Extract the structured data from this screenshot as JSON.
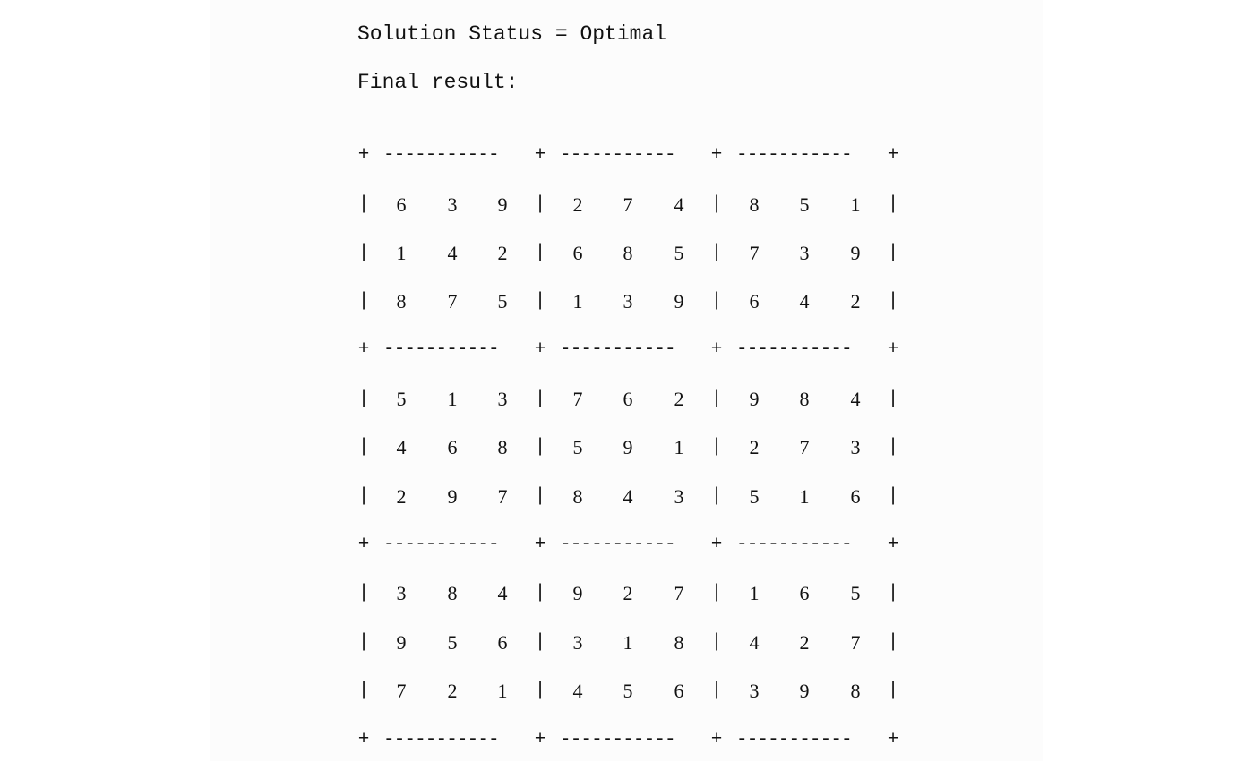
{
  "output": {
    "status_line": "Solution Status = Optimal",
    "result_label": "Final result:"
  },
  "board": {
    "rows": [
      [
        "6",
        "3",
        "9",
        "2",
        "7",
        "4",
        "8",
        "5",
        "1"
      ],
      [
        "1",
        "4",
        "2",
        "6",
        "8",
        "5",
        "7",
        "3",
        "9"
      ],
      [
        "8",
        "7",
        "5",
        "1",
        "3",
        "9",
        "6",
        "4",
        "2"
      ],
      [
        "5",
        "1",
        "3",
        "7",
        "6",
        "2",
        "9",
        "8",
        "4"
      ],
      [
        "4",
        "6",
        "8",
        "5",
        "9",
        "1",
        "2",
        "7",
        "3"
      ],
      [
        "2",
        "9",
        "7",
        "8",
        "4",
        "3",
        "5",
        "1",
        "6"
      ],
      [
        "3",
        "8",
        "4",
        "9",
        "2",
        "7",
        "1",
        "6",
        "5"
      ],
      [
        "9",
        "5",
        "6",
        "3",
        "1",
        "8",
        "4",
        "2",
        "7"
      ],
      [
        "7",
        "2",
        "1",
        "4",
        "5",
        "6",
        "3",
        "9",
        "8"
      ]
    ],
    "corner_glyph": "+",
    "vertical_glyph": "|",
    "separator_glyph": "-----------"
  }
}
